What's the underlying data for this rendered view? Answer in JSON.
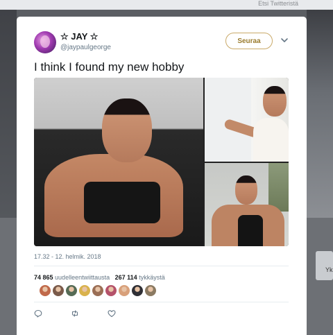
{
  "background": {
    "top_strip_text": "Etsi Twitteristä",
    "side_widget_text": "Yk"
  },
  "tweet": {
    "author_name": "☆ JAY ☆",
    "author_handle": "@jaypaulgeorge",
    "follow_label": "Seuraa",
    "text": "I think I found my new hobby",
    "timestamp": "17.32 - 12. helmik. 2018",
    "retweets_count": "74 865",
    "retweets_label": "uudelleentwiittausta",
    "likes_count": "267 114",
    "likes_label": "tykkäystä"
  },
  "likers": [
    {
      "name": "liker-avatar-1",
      "color": "#c0694a"
    },
    {
      "name": "liker-avatar-2",
      "color": "#7a5a4a"
    },
    {
      "name": "liker-avatar-3",
      "color": "#556b55"
    },
    {
      "name": "liker-avatar-4",
      "color": "#d9b24c"
    },
    {
      "name": "liker-avatar-5",
      "color": "#9a6e55"
    },
    {
      "name": "liker-avatar-6",
      "color": "#b5526a"
    },
    {
      "name": "liker-avatar-7",
      "color": "#d8a07a"
    },
    {
      "name": "liker-avatar-8",
      "color": "#2f2f35"
    },
    {
      "name": "liker-avatar-9",
      "color": "#8b7a62"
    }
  ],
  "colors": {
    "accent": "#c9a968",
    "text": "#14171a",
    "muted": "#657786"
  }
}
